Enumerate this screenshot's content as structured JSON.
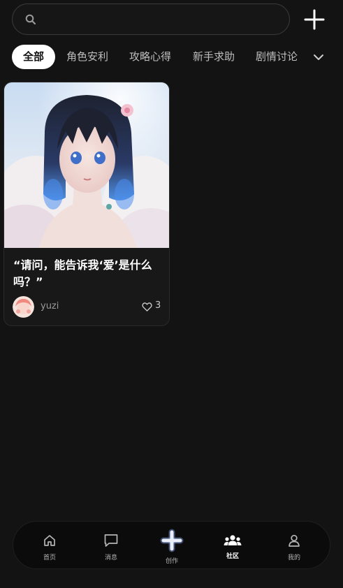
{
  "search": {
    "placeholder": ""
  },
  "tabs": [
    {
      "label": "全部",
      "active": true
    },
    {
      "label": "角色安利",
      "active": false
    },
    {
      "label": "攻略心得",
      "active": false
    },
    {
      "label": "新手求助",
      "active": false
    },
    {
      "label": "剧情讨论",
      "active": false
    }
  ],
  "posts": [
    {
      "title": "“请问，能告诉我‘爱’是什么吗？”",
      "author": "yuzi",
      "likes": "3"
    }
  ],
  "nav": [
    {
      "label": "首页",
      "icon": "home-icon"
    },
    {
      "label": "消息",
      "icon": "message-icon"
    },
    {
      "label": "创作",
      "icon": "create-plus-icon"
    },
    {
      "label": "社区",
      "icon": "community-icon",
      "active": true
    },
    {
      "label": "我的",
      "icon": "profile-icon"
    }
  ],
  "colors": {
    "background": "#131313",
    "tab_active_bg": "#ffffff",
    "nav_bg": "#0b0b0b",
    "create_accent": "#6d86c4"
  }
}
